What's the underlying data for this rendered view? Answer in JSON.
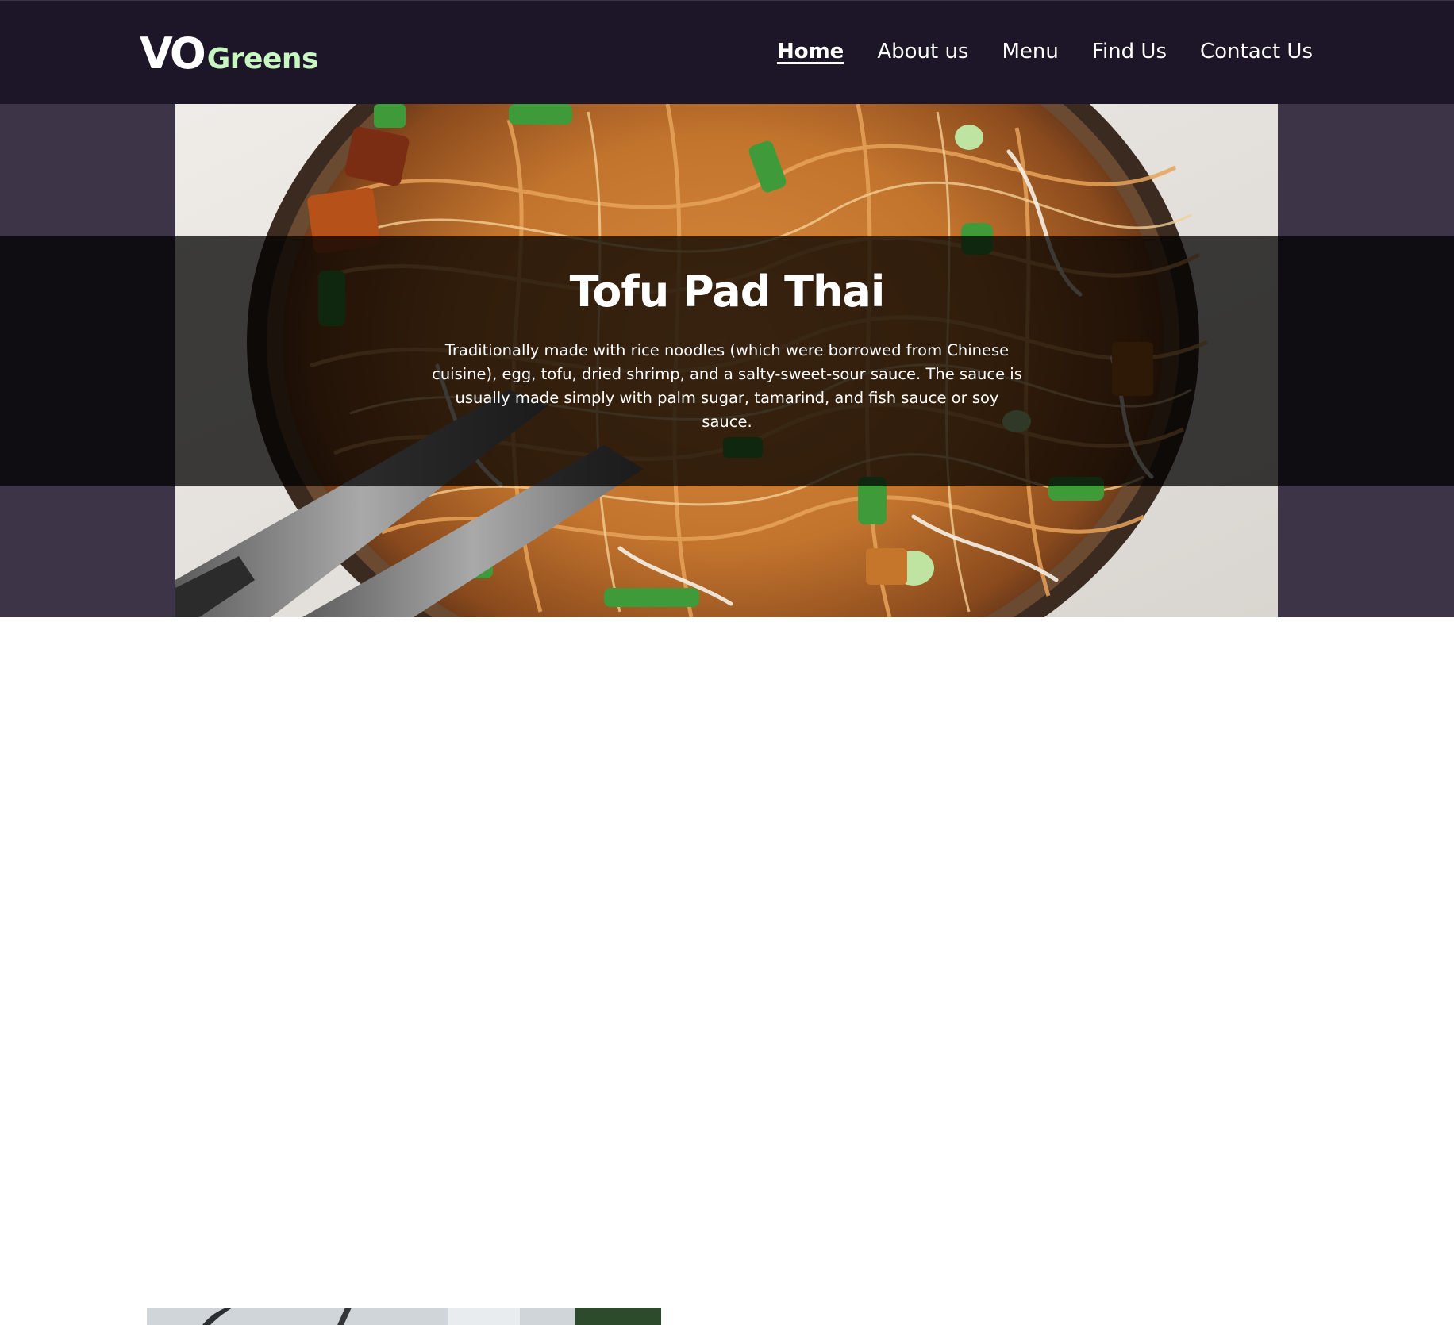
{
  "site": {
    "logo_primary": "VO",
    "logo_secondary": "Greens"
  },
  "nav": {
    "items": [
      {
        "label": "Home",
        "active": true
      },
      {
        "label": "About us",
        "active": false
      },
      {
        "label": "Menu",
        "active": false
      },
      {
        "label": "Find Us",
        "active": false
      },
      {
        "label": "Contact Us",
        "active": false
      }
    ]
  },
  "hero": {
    "title": "Tofu Pad Thai",
    "description": "Traditionally made with rice noodles (which were borrowed from Chinese cuisine), egg, tofu, dried shrimp, and a salty-sweet-sour sauce. The sauce is usually made simply with palm sugar, tamarind, and fish sauce or soy sauce."
  },
  "colors": {
    "header_bg": "#1c1628",
    "logo_accent": "#c9f7c2",
    "hero_side_bg": "#3d3547",
    "overlay": "rgba(0,0,0,0.75)"
  }
}
